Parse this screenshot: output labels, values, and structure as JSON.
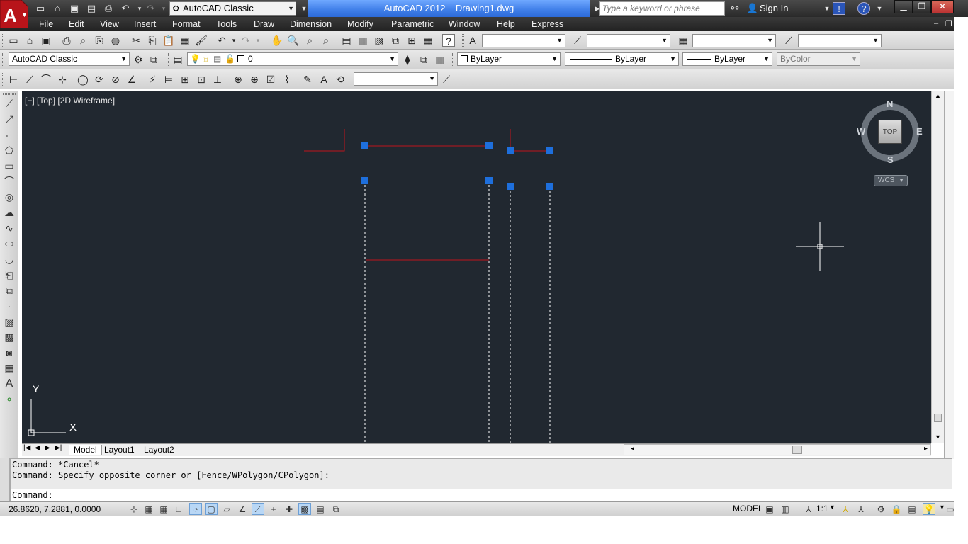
{
  "titlebar": {
    "workspace": "AutoCAD Classic",
    "title": "AutoCAD 2012    Drawing1.dwg",
    "search_placeholder": "Type a keyword or phrase",
    "sign_in": "Sign In"
  },
  "menu": {
    "items": [
      "File",
      "Edit",
      "View",
      "Insert",
      "Format",
      "Tools",
      "Draw",
      "Dimension",
      "Modify",
      "Parametric",
      "Window",
      "Help",
      "Express"
    ]
  },
  "toolbar": {
    "workspace_combo": "AutoCAD Classic",
    "layer_combo": "0",
    "color_combo": "ByLayer",
    "linetype_combo": "ByLayer",
    "lineweight_combo": "ByLayer",
    "plotstyle_combo": "ByColor"
  },
  "viewport": {
    "label": "[−] [Top] [2D Wireframe]",
    "ucs_x": "X",
    "ucs_y": "Y"
  },
  "viewcube": {
    "north": "N",
    "south": "S",
    "east": "E",
    "west": "W",
    "face": "TOP",
    "wcs": "WCS"
  },
  "tabs": [
    "Model",
    "Layout1",
    "Layout2"
  ],
  "command": {
    "line1": "Command: *Cancel*",
    "line2": "Command: Specify opposite corner or [Fence/WPolygon/CPolygon]:",
    "prompt": "Command:"
  },
  "status": {
    "coords": "26.8620, 7.2881, 0.0000",
    "model": "MODEL",
    "scale": "1:1"
  },
  "colors": {
    "canvas_bg": "#212830",
    "grip": "#1e6fdc",
    "line_red": "#c0141c",
    "title_blue": "#3f7ee8"
  }
}
